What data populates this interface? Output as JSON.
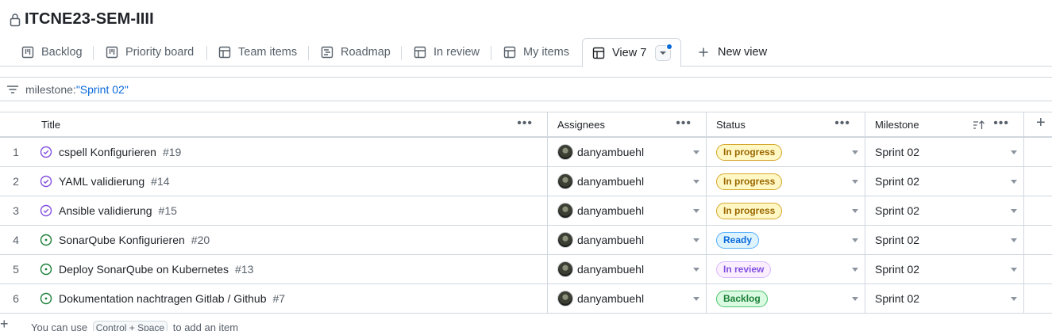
{
  "project": {
    "title": "ITCNE23-SEM-IIII"
  },
  "tabs": [
    {
      "label": "Backlog",
      "icon": "board-icon"
    },
    {
      "label": "Priority board",
      "icon": "board-icon"
    },
    {
      "label": "Team items",
      "icon": "table-icon"
    },
    {
      "label": "Roadmap",
      "icon": "roadmap-icon"
    },
    {
      "label": "In review",
      "icon": "table-icon"
    },
    {
      "label": "My items",
      "icon": "table-icon"
    },
    {
      "label": "View 7",
      "icon": "table-icon",
      "active": true
    }
  ],
  "new_view_label": "New view",
  "filter": {
    "key": "milestone:",
    "value": "\"Sprint 02\""
  },
  "columns": {
    "title": "Title",
    "assignees": "Assignees",
    "status": "Status",
    "milestone": "Milestone"
  },
  "colors": {
    "issue_closed": "#8250df",
    "issue_open": "#1a7f37",
    "accent": "#0969da",
    "status_in_progress": {
      "bg": "#fff8c5",
      "fg": "#9a6700",
      "border": "#d4a72c"
    },
    "status_ready": {
      "bg": "#ddf4ff",
      "fg": "#0969da",
      "border": "#54aeff"
    },
    "status_in_review": {
      "bg": "#fbefff",
      "fg": "#8250df",
      "border": "#d8b9ff"
    },
    "status_backlog": {
      "bg": "#dafbe1",
      "fg": "#1a7f37",
      "border": "#4ac26b"
    }
  },
  "rows": [
    {
      "num": "1",
      "state": "closed",
      "title": "cspell Konfigurieren",
      "issue": "#19",
      "assignee": "danyambuehl",
      "status": "In progress",
      "status_key": "status_in_progress",
      "milestone": "Sprint 02"
    },
    {
      "num": "2",
      "state": "closed",
      "title": "YAML validierung",
      "issue": "#14",
      "assignee": "danyambuehl",
      "status": "In progress",
      "status_key": "status_in_progress",
      "milestone": "Sprint 02"
    },
    {
      "num": "3",
      "state": "closed",
      "title": "Ansible validierung",
      "issue": "#15",
      "assignee": "danyambuehl",
      "status": "In progress",
      "status_key": "status_in_progress",
      "milestone": "Sprint 02"
    },
    {
      "num": "4",
      "state": "open",
      "title": "SonarQube Konfigurieren",
      "issue": "#20",
      "assignee": "danyambuehl",
      "status": "Ready",
      "status_key": "status_ready",
      "milestone": "Sprint 02"
    },
    {
      "num": "5",
      "state": "open",
      "title": "Deploy SonarQube on Kubernetes",
      "issue": "#13",
      "assignee": "danyambuehl",
      "status": "In review",
      "status_key": "status_in_review",
      "milestone": "Sprint 02"
    },
    {
      "num": "6",
      "state": "open",
      "title": "Dokumentation nachtragen Gitlab / Github",
      "issue": "#7",
      "assignee": "danyambuehl",
      "status": "Backlog",
      "status_key": "status_backlog",
      "milestone": "Sprint 02"
    }
  ],
  "add_item": {
    "prefix": "You can use",
    "shortcut": "Control + Space",
    "suffix": "to add an item"
  }
}
